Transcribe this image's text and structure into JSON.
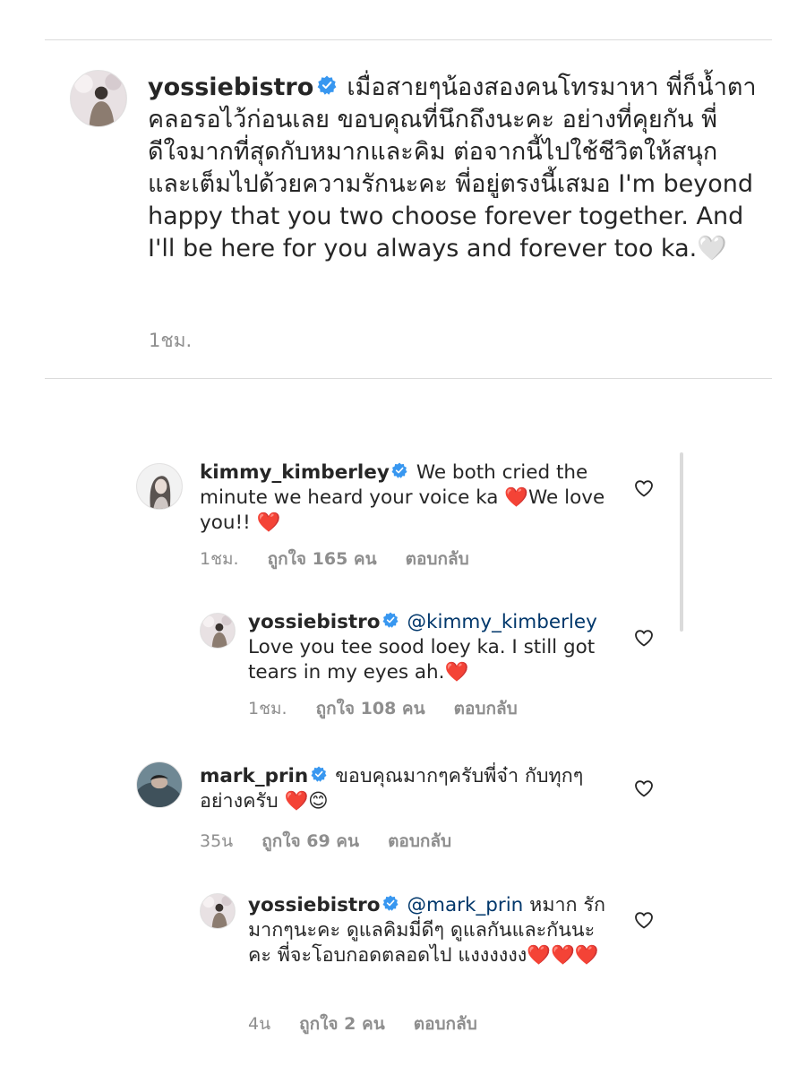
{
  "main_comment": {
    "username": "yossiebistro",
    "text_before_emoji": "เมื่อสายๆน้องสองคนโทรมาหา พี่ก็น้ำตาคลอรอไว้ก่อนเลย ขอบคุณที่นึกถึงนะคะ อย่างที่คุยกัน พี่ดีใจมากที่สุดกับหมากและคิม ต่อจากนี้ไปใช้ชีวิตให้สนุกและเต็มไปด้วยความรักนะคะ พี่อยู่ตรงนี้เสมอ I'm beyond happy that you two choose forever together. And I'll be here for you always and forever too ka.",
    "emoji": "🤍",
    "time": "1ชม."
  },
  "replies": [
    {
      "username": "kimmy_kimberley",
      "mention": "",
      "text": "We both cried the minute we heard your voice ka ❤️We love you!! ❤️",
      "time": "1ชม.",
      "likes": "ถูกใจ 165 คน",
      "reply_label": "ตอบกลับ"
    },
    {
      "username": "yossiebistro",
      "mention": "@kimmy_kimberley",
      "text": "Love you tee sood loey ka. I still got tears in my eyes ah.❤️",
      "time": "1ชม.",
      "likes": "ถูกใจ 108 คน",
      "reply_label": "ตอบกลับ"
    },
    {
      "username": "mark_prin",
      "mention": "",
      "text": "ขอบคุณมากๆครับพี่จ๋า กับทุกๆอย่างครับ ❤️😊",
      "time": "35น",
      "likes": "ถูกใจ 69 คน",
      "reply_label": "ตอบกลับ"
    },
    {
      "username": "yossiebistro",
      "mention": "@mark_prin",
      "text": "หมาก รักมากๆนะคะ ดูแลคิมมี่ดีๆ ดูแลกันและกันนะคะ พี่จะโอบกอดตลอดไป แงงงงงง❤️❤️❤️",
      "time": "4น",
      "likes": "ถูกใจ 2 คน",
      "reply_label": "ตอบกลับ"
    }
  ],
  "colors": {
    "verified": "#3897f0",
    "mention": "#00376b",
    "meta": "#8e8e8e",
    "text": "#262626"
  },
  "icons": {
    "verified": "verified-badge-icon",
    "like": "heart-outline-icon"
  }
}
